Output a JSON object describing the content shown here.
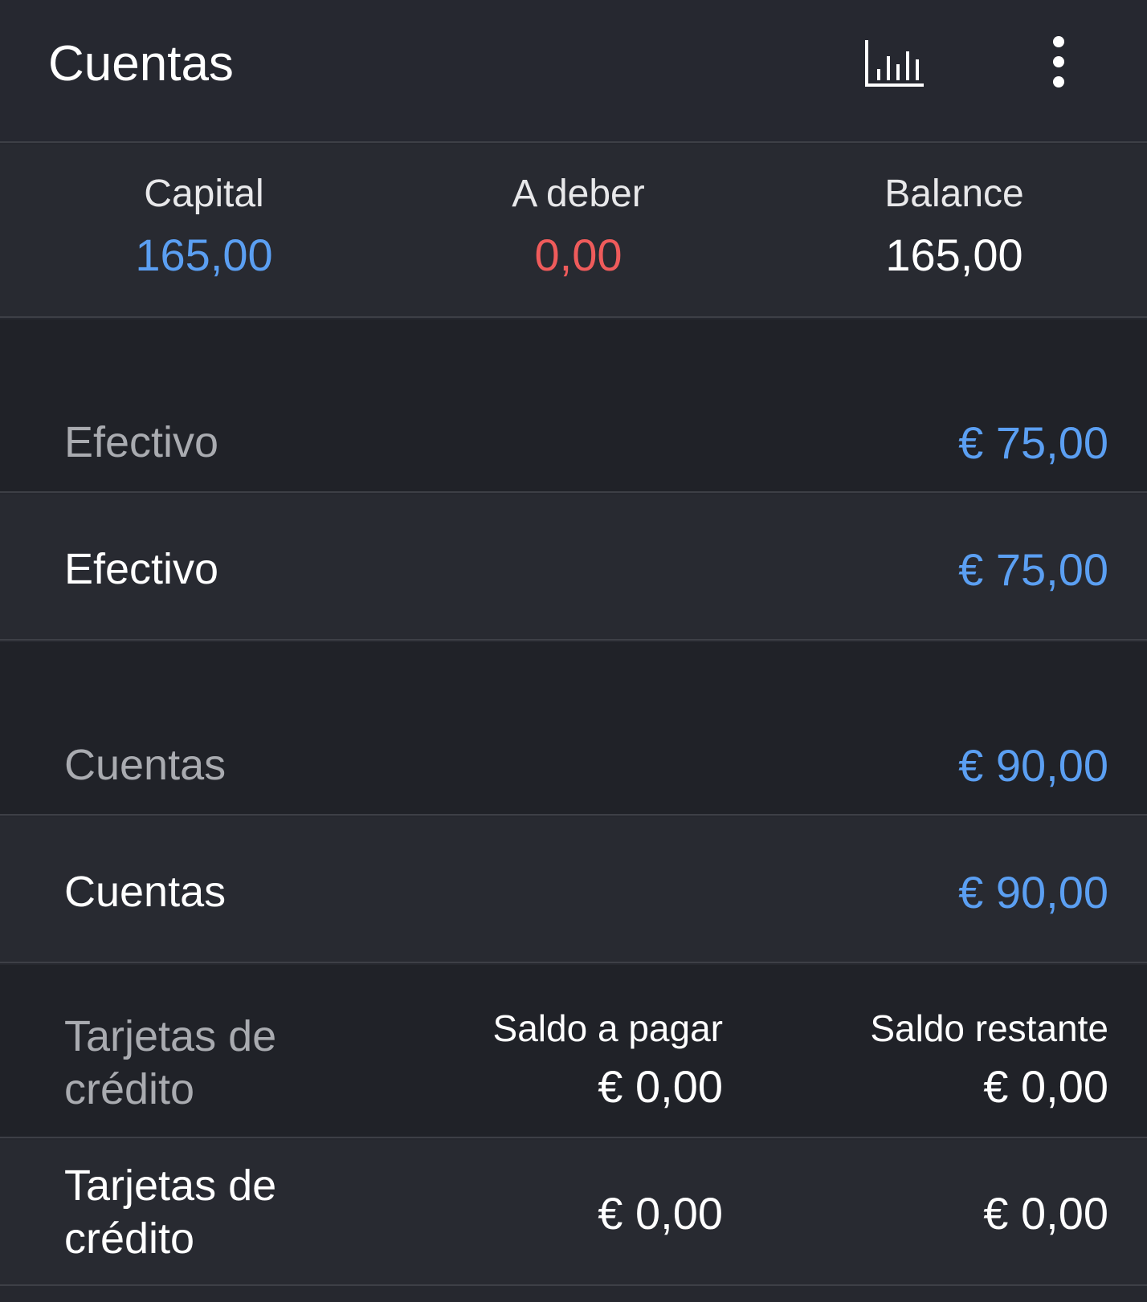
{
  "appbar": {
    "title": "Cuentas",
    "stats_icon": "bar-chart-icon",
    "more_icon": "more-vert-icon"
  },
  "summary": {
    "capital_label": "Capital",
    "capital_value": "165,00",
    "debt_label": "A deber",
    "debt_value": "0,00",
    "balance_label": "Balance",
    "balance_value": "165,00"
  },
  "groups": {
    "cash": {
      "label": "Efectivo",
      "total": "€ 75,00",
      "account_name": "Efectivo",
      "account_amount": "€ 75,00"
    },
    "accounts": {
      "label": "Cuentas",
      "total": "€ 90,00",
      "account_name": "Cuentas",
      "account_amount": "€ 90,00"
    },
    "credit_cards": {
      "label": "Tarjetas de crédito",
      "payable_label": "Saldo a pagar",
      "payable_total": "€ 0,00",
      "remaining_label": "Saldo restante",
      "remaining_total": "€ 0,00",
      "account_name": "Tarjetas de crédito",
      "account_payable": "€ 0,00",
      "account_remaining": "€ 0,00"
    }
  },
  "colors": {
    "positive": "#5b9ff2",
    "negative": "#ef5b5b",
    "background": "#26282f"
  }
}
